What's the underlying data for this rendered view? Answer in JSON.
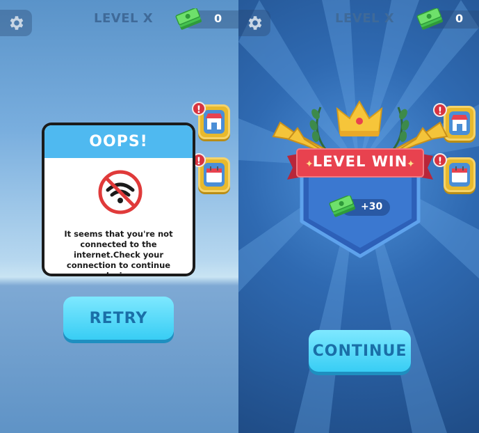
{
  "left_screen": {
    "level_title": "LEVEL X",
    "cash": "0",
    "dialog": {
      "title": "OOPS!",
      "icon": "no-wifi-icon",
      "message": "It seems that you're not connected to the internet.Check your connection to continue playing."
    },
    "retry_label": "RETRY",
    "side_buttons": [
      {
        "icon": "shop-icon",
        "badge": "!"
      },
      {
        "icon": "calendar-icon",
        "badge": "!"
      }
    ]
  },
  "right_screen": {
    "level_title": "LEVEL X",
    "cash": "0",
    "banner": "LEVEL WIN",
    "reward": "+30",
    "continue_label": "CONTINUE",
    "side_buttons": [
      {
        "icon": "shop-icon",
        "badge": "!"
      },
      {
        "icon": "calendar-icon",
        "badge": "!"
      }
    ]
  },
  "colors": {
    "accent_blue": "#4fb9f0",
    "button_cyan": "#38cdf4",
    "banner_red": "#e8424f",
    "gold": "#e8b92c",
    "alert_red": "#d8333f"
  }
}
